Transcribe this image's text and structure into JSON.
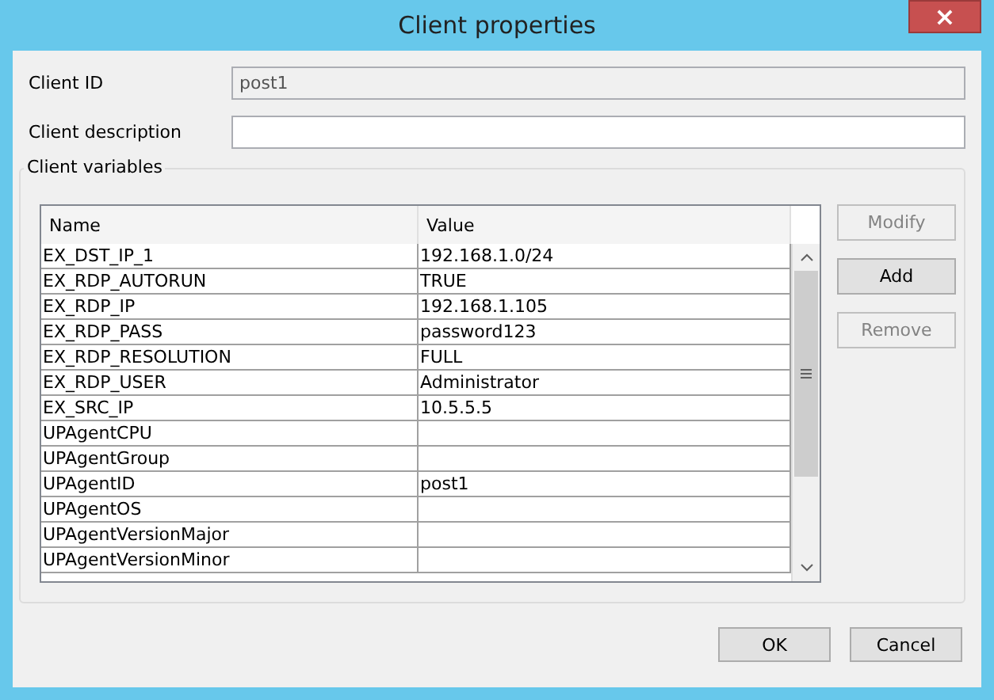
{
  "window": {
    "title": "Client properties",
    "close": "×"
  },
  "fields": [
    {
      "label": "Client ID",
      "value": "post1",
      "disabled": true
    },
    {
      "label": "Client description",
      "disabled": false
    }
  ],
  "group": {
    "title": "Client variables"
  },
  "table": {
    "columns": [
      "Name",
      "Value"
    ],
    "rows": [
      {
        "name": "EX_DST_IP_1",
        "value": "192.168.1.0/24"
      },
      {
        "name": "EX_RDP_AUTORUN",
        "value": "TRUE"
      },
      {
        "name": "EX_RDP_IP",
        "value": "192.168.1.105"
      },
      {
        "name": "EX_RDP_PASS",
        "value": "password123"
      },
      {
        "name": "EX_RDP_RESOLUTION",
        "value": "FULL"
      },
      {
        "name": "EX_RDP_USER",
        "value": "Administrator"
      },
      {
        "name": "EX_SRC_IP",
        "value": "10.5.5.5"
      },
      {
        "name": "UPAgentCPU"
      },
      {
        "name": "UPAgentGroup"
      },
      {
        "name": "UPAgentID",
        "value": "post1"
      },
      {
        "name": "UPAgentOS"
      },
      {
        "name": "UPAgentVersionMajor"
      },
      {
        "name": "UPAgentVersionMinor"
      }
    ]
  },
  "side_buttons": [
    {
      "label": "Modify",
      "disabled": true
    },
    {
      "label": "Add",
      "disabled": false
    },
    {
      "label": "Remove",
      "disabled": true
    }
  ],
  "buttons": [
    "OK",
    "Cancel"
  ]
}
